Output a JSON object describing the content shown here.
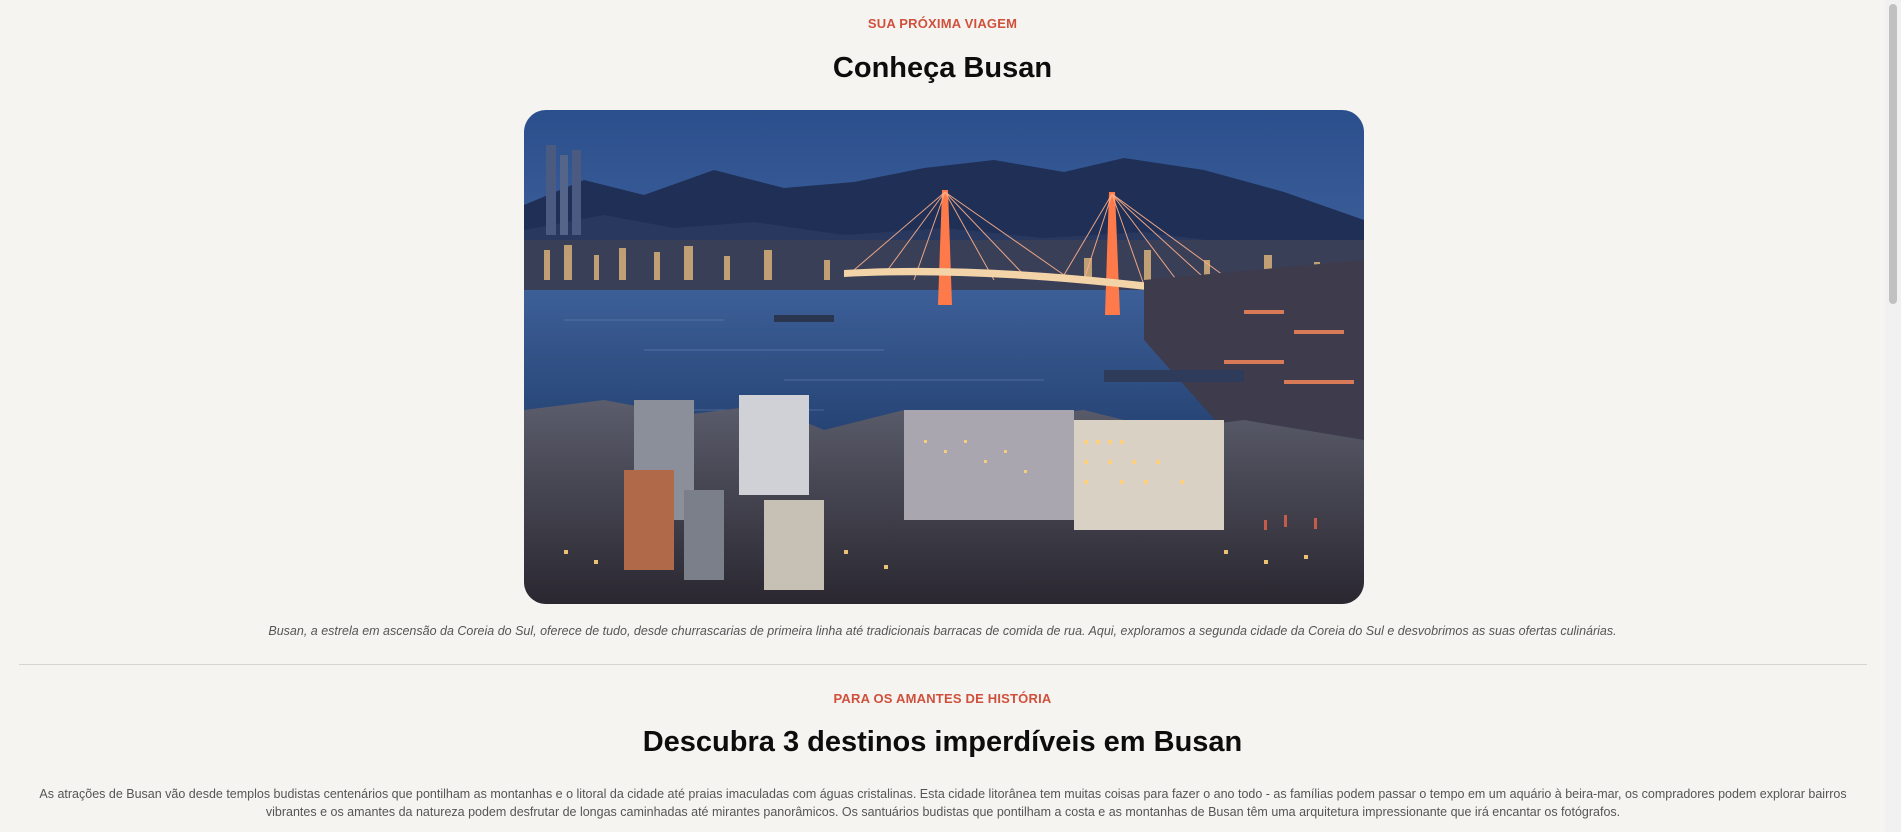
{
  "intro": {
    "eyebrow": "SUA PRÓXIMA VIAGEM",
    "title": "Conheça Busan",
    "image_alt": "Busan harbor at dusk with bridge and city lights",
    "caption": "Busan, a estrela em ascensão da Coreia do Sul, oferece de tudo, desde churrascarias de primeira linha até tradicionais barracas de comida de rua. Aqui, exploramos a segunda cidade da Coreia do Sul e desvobrimos as suas ofertas culinárias."
  },
  "section": {
    "eyebrow": "PARA OS AMANTES DE HISTÓRIA",
    "title": "Descubra 3 destinos imperdíveis em Busan",
    "body": "As atrações de Busan vão desde templos budistas centenários que pontilham as montanhas e o litoral da cidade até praias imaculadas com águas cristalinas. Esta cidade litorânea tem muitas coisas para fazer o ano todo - as famílias podem passar o tempo em um aquário à beira-mar, os compradores podem explorar bairros vibrantes e os amantes da natureza podem desfrutar de longas caminhadas até mirantes panorâmicos. Os santuários budistas que pontilham a costa e as montanhas de Busan têm uma arquitetura impressionante que irá encantar os fotógrafos."
  },
  "colors": {
    "accent": "#d0503c",
    "background": "#f5f4f1",
    "heading": "#0d0d0d",
    "muted_text": "#555555"
  }
}
